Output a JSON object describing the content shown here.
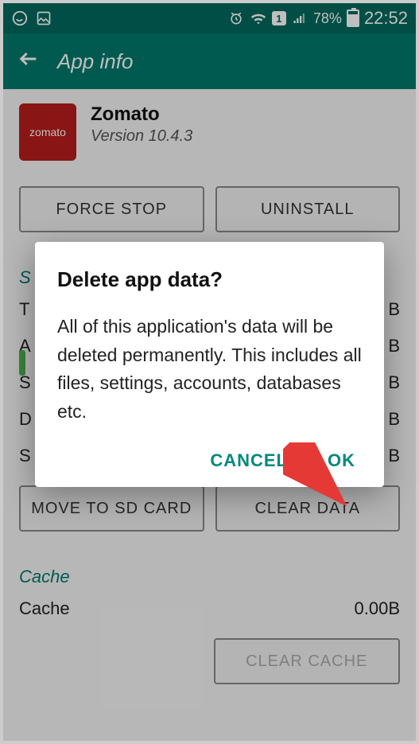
{
  "status": {
    "battery_pct": "78%",
    "time": "22:52",
    "sim": "1"
  },
  "appbar": {
    "title": "App info"
  },
  "app": {
    "name": "Zomato",
    "version": "Version 10.4.3",
    "icon_text": "zomato"
  },
  "buttons": {
    "force_stop": "FORCE STOP",
    "uninstall": "UNINSTALL",
    "move_sd": "MOVE TO SD CARD",
    "clear_data": "CLEAR DATA",
    "clear_cache": "CLEAR CACHE"
  },
  "sections": {
    "storage": "S",
    "cache": "Cache"
  },
  "storage_rows": [
    {
      "label": "T",
      "value": "B"
    },
    {
      "label": "A",
      "value": "B"
    },
    {
      "label": "S",
      "value": "B"
    },
    {
      "label": "D",
      "value": "B"
    },
    {
      "label": "S",
      "value": "B"
    }
  ],
  "cache_row": {
    "label": "Cache",
    "value": "0.00B"
  },
  "dialog": {
    "title": "Delete app data?",
    "message": "All of this application's data will be deleted permanently. This includes all files, settings, accounts, databases etc.",
    "cancel": "CANCEL",
    "ok": "OK"
  }
}
